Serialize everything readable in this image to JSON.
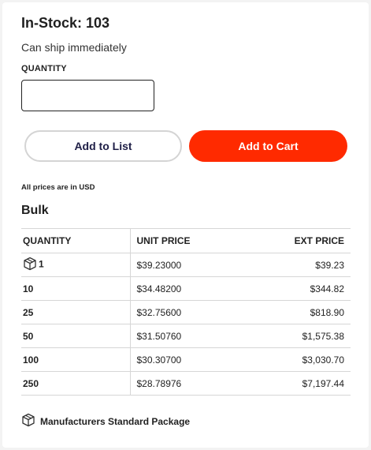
{
  "stock": {
    "title": "In-Stock: 103",
    "note": "Can ship immediately"
  },
  "quantity": {
    "label": "QUANTITY",
    "value": "",
    "placeholder": ""
  },
  "buttons": {
    "add_to_list": "Add to List",
    "add_to_cart": "Add to Cart"
  },
  "colors": {
    "cart_button": "#ff2a00",
    "list_button_text": "#1e1e46"
  },
  "currency_note": "All prices are in USD",
  "bulk": {
    "title": "Bulk",
    "columns": [
      "QUANTITY",
      "UNIT PRICE",
      "EXT PRICE"
    ],
    "rows": [
      {
        "qty": "1",
        "unit": "$39.23000",
        "ext": "$39.23",
        "icon": "package-icon"
      },
      {
        "qty": "10",
        "unit": "$34.48200",
        "ext": "$344.82"
      },
      {
        "qty": "25",
        "unit": "$32.75600",
        "ext": "$818.90"
      },
      {
        "qty": "50",
        "unit": "$31.50760",
        "ext": "$1,575.38"
      },
      {
        "qty": "100",
        "unit": "$30.30700",
        "ext": "$3,030.70"
      },
      {
        "qty": "250",
        "unit": "$28.78976",
        "ext": "$7,197.44"
      }
    ]
  },
  "footer": {
    "package_note": "Manufacturers Standard Package",
    "icon": "package-icon"
  }
}
